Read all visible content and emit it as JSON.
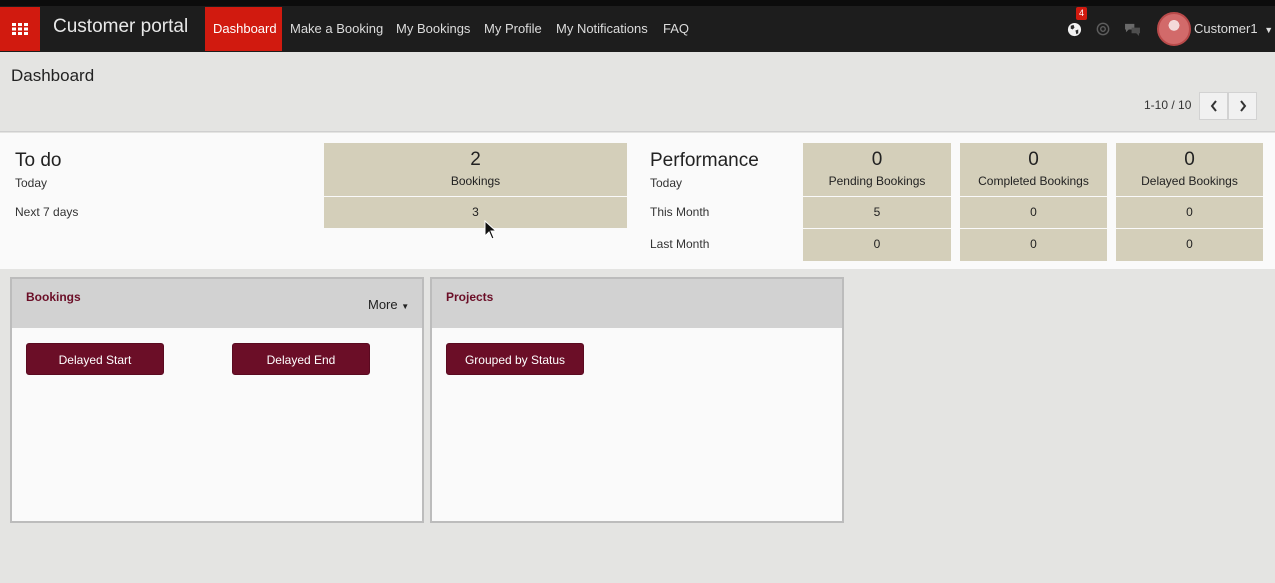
{
  "app": {
    "brand": "Customer portal",
    "nav": [
      "Dashboard",
      "Make a Booking",
      "My Bookings",
      "My Profile",
      "My Notifications",
      "FAQ"
    ],
    "active_nav": "Dashboard",
    "notification_count": "4",
    "user": "Customer1",
    "accent_color": "#d11a0f",
    "icons": [
      "apps-grid-icon",
      "globe-icon",
      "at-sign-icon",
      "chat-bubbles-icon",
      "caret-down-icon"
    ]
  },
  "page": {
    "title": "Dashboard",
    "pager": "1-10 / 10"
  },
  "todo": {
    "heading": "To do",
    "row_today": "Today",
    "row_next7": "Next 7 days",
    "bookings_today": "2",
    "bookings_label": "Bookings",
    "bookings_next7": "3"
  },
  "performance": {
    "heading": "Performance",
    "row_today": "Today",
    "row_month": "This Month",
    "row_last_month": "Last Month",
    "columns": [
      {
        "label": "Pending Bookings",
        "today": "0",
        "this_month": "5",
        "last_month": "0"
      },
      {
        "label": "Completed Bookings",
        "today": "0",
        "this_month": "0",
        "last_month": "0"
      },
      {
        "label": "Delayed Bookings",
        "today": "0",
        "this_month": "0",
        "last_month": "0"
      }
    ]
  },
  "panels": {
    "bookings": {
      "title": "Bookings",
      "more": "More",
      "buttons": [
        "Delayed Start",
        "Delayed End"
      ]
    },
    "projects": {
      "title": "Projects",
      "buttons": [
        "Grouped by Status"
      ]
    },
    "button_color": "#6b0e27"
  }
}
